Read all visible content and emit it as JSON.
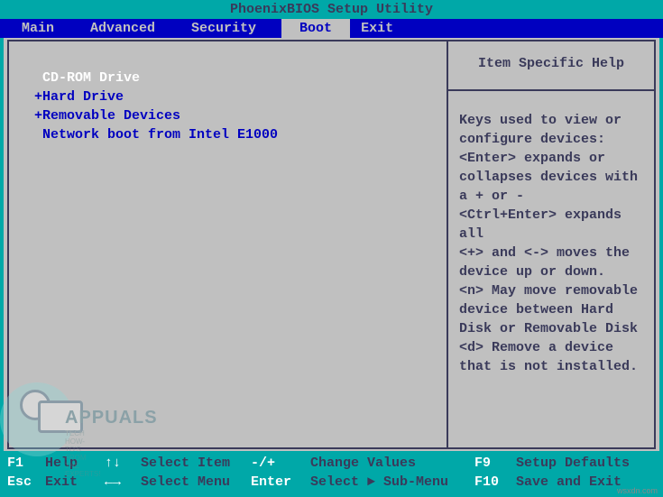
{
  "title": "PhoenixBIOS Setup Utility",
  "menu": {
    "items": [
      "Main",
      "Advanced",
      "Security",
      "Boot",
      "Exit"
    ],
    "active": "Boot"
  },
  "boot_list": {
    "items": [
      {
        "label": "CD-ROM Drive",
        "prefix": " ",
        "selected": true
      },
      {
        "label": "Hard Drive",
        "prefix": "+",
        "selected": false
      },
      {
        "label": "Removable Devices",
        "prefix": "+",
        "selected": false
      },
      {
        "label": "Network boot from Intel E1000",
        "prefix": " ",
        "selected": false
      }
    ]
  },
  "help": {
    "title": "Item Specific Help",
    "body": "Keys used to view or configure devices:\n<Enter> expands or collapses devices with a + or -\n<Ctrl+Enter> expands all\n<+> and <-> moves the device up or down.\n<n> May move removable device between Hard Disk or Removable Disk\n<d> Remove a device that is not installed."
  },
  "footer": {
    "row1": {
      "k1": "F1",
      "l1": "Help",
      "k2": "↑↓",
      "l2": "Select Item",
      "k3": "-/+",
      "l3": "Change Values",
      "k4": "F9",
      "l4": "Setup Defaults"
    },
    "row2": {
      "k1": "Esc",
      "l1": "Exit",
      "k2": "←→",
      "l2": "Select Menu",
      "k3": "Enter",
      "l3": "Select ► Sub-Menu",
      "k4": "F10",
      "l4": "Save and Exit"
    }
  },
  "watermark": {
    "brand": "APPUALS",
    "tag1": "TECH HOW-TO'S FROM",
    "tag2": "THE EXPERTS!"
  },
  "attrib": "wsxdn.com"
}
